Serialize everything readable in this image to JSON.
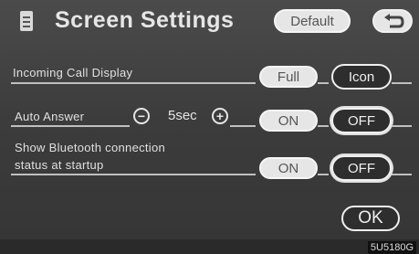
{
  "header": {
    "title": "Screen Settings",
    "default_label": "Default",
    "icon": "phone-settings-icon",
    "back_icon": "return-arrow-icon"
  },
  "rows": [
    {
      "label": "Incoming Call Display",
      "options": [
        "Full",
        "Icon"
      ],
      "selected": "Full"
    },
    {
      "label": "Auto Answer",
      "value": "5sec",
      "minus": "−",
      "plus": "+",
      "options": [
        "ON",
        "OFF"
      ],
      "selected": "OFF"
    },
    {
      "label_line1": "Show Bluetooth connection",
      "label_line2": "status at startup",
      "options": [
        "ON",
        "OFF"
      ],
      "selected": "OFF"
    }
  ],
  "footer": {
    "ok_label": "OK",
    "code": "5U5180G"
  },
  "colors": {
    "background": "#3c3c3c",
    "button_light": "#e6e6e6",
    "button_dark": "#2e2e2e",
    "text": "#e0e0e0"
  }
}
